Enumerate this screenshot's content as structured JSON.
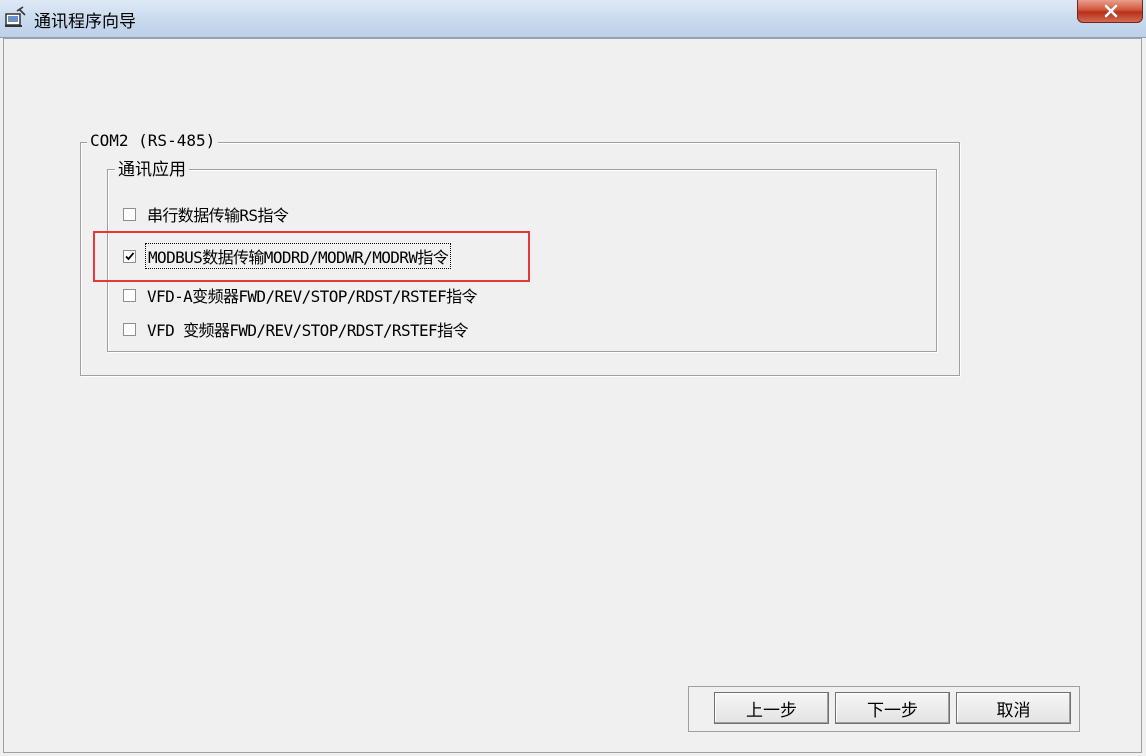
{
  "window": {
    "title": "通讯程序向导",
    "icon": "wizard-app-icon",
    "close_icon": "close-icon"
  },
  "outer_group": {
    "label": "COM2 (RS-485)"
  },
  "inner_group": {
    "label": "通讯应用",
    "options": [
      {
        "label": "串行数据传输RS指令",
        "checked": false
      },
      {
        "label": "MODBUS数据传输MODRD/MODWR/MODRW指令",
        "checked": true
      },
      {
        "label": "VFD-A变频器FWD/REV/STOP/RDST/RSTEF指令",
        "checked": false
      },
      {
        "label": "VFD 变频器FWD/REV/STOP/RDST/RSTEF指令",
        "checked": false
      }
    ]
  },
  "buttons": {
    "prev": "上一步",
    "next": "下一步",
    "cancel": "取消"
  },
  "colors": {
    "highlight": "#e53935",
    "background": "#f0f0f0"
  }
}
